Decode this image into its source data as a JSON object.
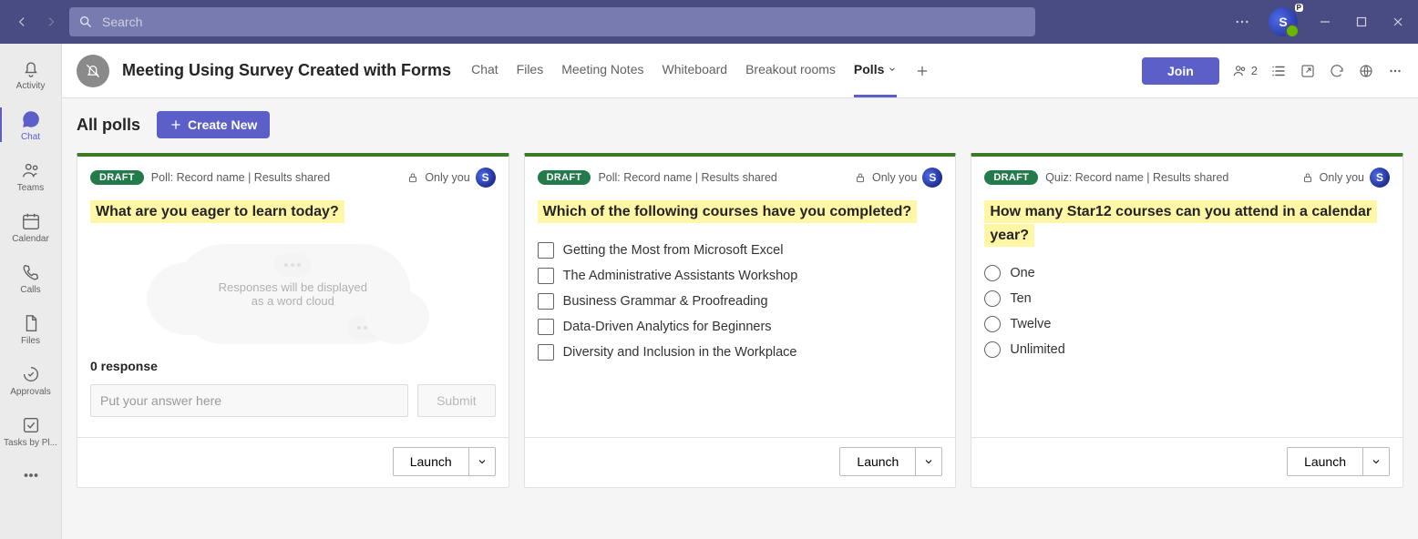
{
  "titlebar": {
    "search_placeholder": "Search",
    "avatar_letter": "S",
    "avatar_badge": "P"
  },
  "rail": {
    "items": [
      {
        "label": "Activity"
      },
      {
        "label": "Chat"
      },
      {
        "label": "Teams"
      },
      {
        "label": "Calendar"
      },
      {
        "label": "Calls"
      },
      {
        "label": "Files"
      },
      {
        "label": "Approvals"
      },
      {
        "label": "Tasks by Pl..."
      }
    ]
  },
  "meeting": {
    "title": "Meeting Using Survey Created with Forms",
    "tabs": [
      {
        "label": "Chat"
      },
      {
        "label": "Files"
      },
      {
        "label": "Meeting Notes"
      },
      {
        "label": "Whiteboard"
      },
      {
        "label": "Breakout rooms"
      },
      {
        "label": "Polls"
      }
    ],
    "join_label": "Join",
    "participant_count": "2"
  },
  "polls": {
    "heading": "All polls",
    "create_label": "Create New",
    "draft_label": "DRAFT",
    "only_you_label": "Only you",
    "launch_label": "Launch",
    "author_initial": "S",
    "cards": [
      {
        "meta": "Poll: Record name | Results shared",
        "question": "What are you eager to learn today?",
        "wordcloud_hint": "Responses will be displayed as a word cloud",
        "response_count": "0 response",
        "answer_placeholder": "Put your answer here",
        "submit_label": "Submit"
      },
      {
        "meta": "Poll: Record name | Results shared",
        "question": "Which of the following courses have you completed?",
        "options": [
          "Getting the Most from Microsoft Excel",
          "The Administrative Assistants Workshop",
          "Business Grammar & Proofreading",
          "Data-Driven Analytics for Beginners",
          "Diversity and Inclusion in the Workplace"
        ]
      },
      {
        "meta": "Quiz: Record name | Results shared",
        "question": "How many Star12 courses can you attend in a calendar year?",
        "options": [
          "One",
          "Ten",
          "Twelve",
          "Unlimited"
        ]
      }
    ]
  }
}
